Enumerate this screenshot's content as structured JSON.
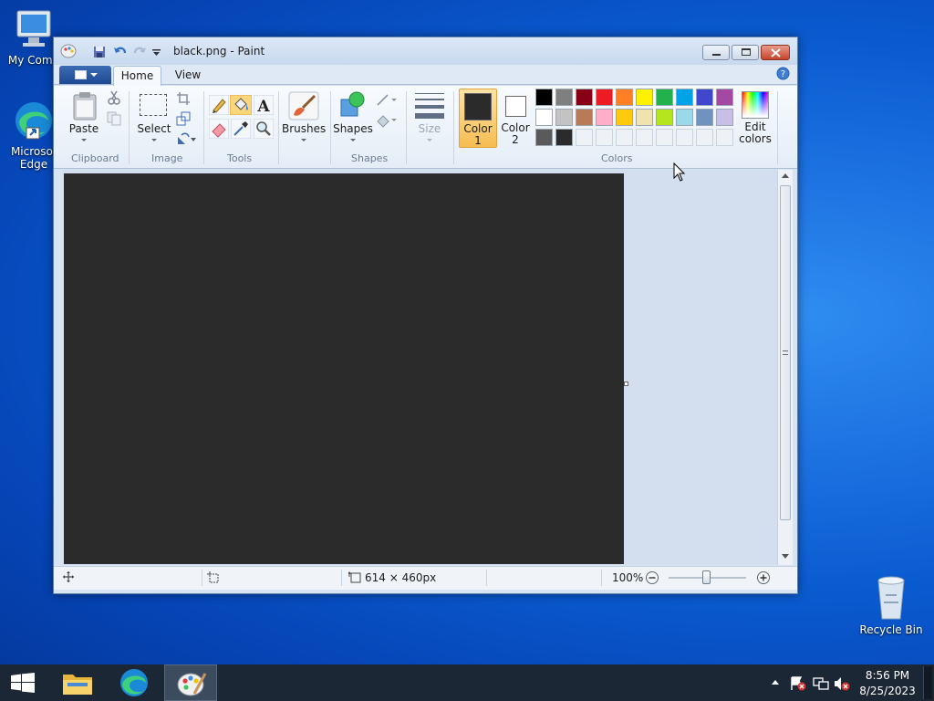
{
  "desktop": {
    "icons": [
      {
        "label": "My Comp"
      },
      {
        "label": "Microsof Edge"
      },
      {
        "label": "Recycle Bin"
      }
    ]
  },
  "window": {
    "title": "black.png - Paint",
    "tabs": {
      "home": "Home",
      "view": "View"
    },
    "ribbon": {
      "paste": "Paste",
      "select": "Select",
      "brushes": "Brushes",
      "shapes": "Shapes",
      "size": "Size",
      "color1": "Color 1",
      "color2": "Color 2",
      "edit_colors": "Edit colors",
      "groups": {
        "clipboard": "Clipboard",
        "image": "Image",
        "tools": "Tools",
        "shapes": "Shapes",
        "colors": "Colors"
      }
    },
    "palette": {
      "row1": [
        "#000000",
        "#7f7f7f",
        "#880015",
        "#ed1c24",
        "#ff7f27",
        "#fff200",
        "#22b14c",
        "#00a2e8",
        "#3f48cc",
        "#a349a4"
      ],
      "row2": [
        "#ffffff",
        "#c3c3c3",
        "#b97a57",
        "#ffaec9",
        "#ffc90e",
        "#efe4b0",
        "#b5e61d",
        "#99d9ea",
        "#7092be",
        "#c8bfe7"
      ],
      "row3": [
        "#5a5a5a",
        "#2b2b2b"
      ]
    },
    "color1": "#2b2b2b",
    "color2": "#ffffff",
    "canvas_color": "#2b2b2b",
    "status": {
      "size_text": "614 × 460px",
      "zoom": "100%"
    }
  },
  "taskbar": {
    "time": "8:56 PM",
    "date": "8/25/2023"
  }
}
